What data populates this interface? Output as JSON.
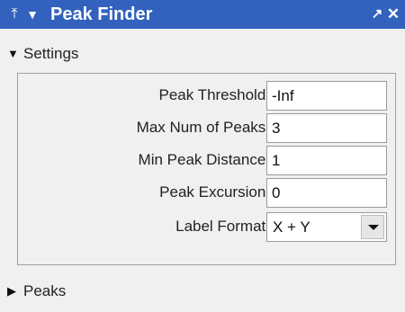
{
  "titlebar": {
    "title": "Peak Finder",
    "pin_glyph": "⤒",
    "menu_glyph": "▼",
    "undock_glyph": "↗",
    "close_glyph": "✕",
    "background": "#3262be"
  },
  "settings": {
    "header_label": "Settings",
    "expanded": true,
    "fields": [
      {
        "label": "Peak Threshold:",
        "value": "-Inf"
      },
      {
        "label": "Max Num of Peaks:",
        "value": "3"
      },
      {
        "label": "Min Peak Distance:",
        "value": "1"
      },
      {
        "label": "Peak Excursion:",
        "value": "0"
      }
    ],
    "label_format": {
      "label": "Label Format:",
      "selected": "X + Y"
    }
  },
  "peaks": {
    "header_label": "Peaks",
    "expanded": false
  }
}
